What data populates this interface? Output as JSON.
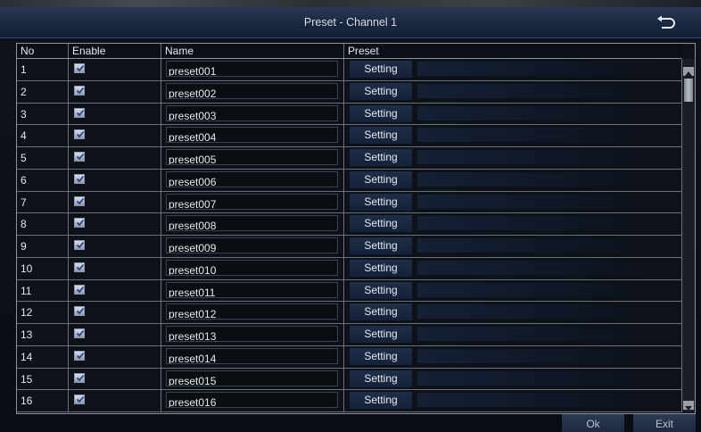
{
  "window": {
    "title": "Preset - Channel 1"
  },
  "table": {
    "headers": {
      "no": "No",
      "enable": "Enable",
      "name": "Name",
      "preset": "Preset"
    },
    "rows": [
      {
        "no": "1",
        "enabled": true,
        "name": "preset001",
        "action": "Setting"
      },
      {
        "no": "2",
        "enabled": true,
        "name": "preset002",
        "action": "Setting"
      },
      {
        "no": "3",
        "enabled": true,
        "name": "preset003",
        "action": "Setting"
      },
      {
        "no": "4",
        "enabled": true,
        "name": "preset004",
        "action": "Setting"
      },
      {
        "no": "5",
        "enabled": true,
        "name": "preset005",
        "action": "Setting"
      },
      {
        "no": "6",
        "enabled": true,
        "name": "preset006",
        "action": "Setting"
      },
      {
        "no": "7",
        "enabled": true,
        "name": "preset007",
        "action": "Setting"
      },
      {
        "no": "8",
        "enabled": true,
        "name": "preset008",
        "action": "Setting"
      },
      {
        "no": "9",
        "enabled": true,
        "name": "preset009",
        "action": "Setting"
      },
      {
        "no": "10",
        "enabled": true,
        "name": "preset010",
        "action": "Setting"
      },
      {
        "no": "11",
        "enabled": true,
        "name": "preset011",
        "action": "Setting"
      },
      {
        "no": "12",
        "enabled": true,
        "name": "preset012",
        "action": "Setting"
      },
      {
        "no": "13",
        "enabled": true,
        "name": "preset013",
        "action": "Setting"
      },
      {
        "no": "14",
        "enabled": true,
        "name": "preset014",
        "action": "Setting"
      },
      {
        "no": "15",
        "enabled": true,
        "name": "preset015",
        "action": "Setting"
      },
      {
        "no": "16",
        "enabled": true,
        "name": "preset016",
        "action": "Setting"
      }
    ]
  },
  "footer": {
    "ok_label": "Ok",
    "exit_label": "Exit"
  },
  "icons": {
    "back": "back-arrow-icon",
    "checkbox": "checkmark-icon",
    "scroll_up": "scroll-up-arrow-icon",
    "scroll_down": "scroll-down-arrow-icon"
  },
  "colors": {
    "title_bar": "#1a2740",
    "background": "#0b0f16",
    "button": "#1e2e48",
    "grid_line": "#6b717a"
  }
}
